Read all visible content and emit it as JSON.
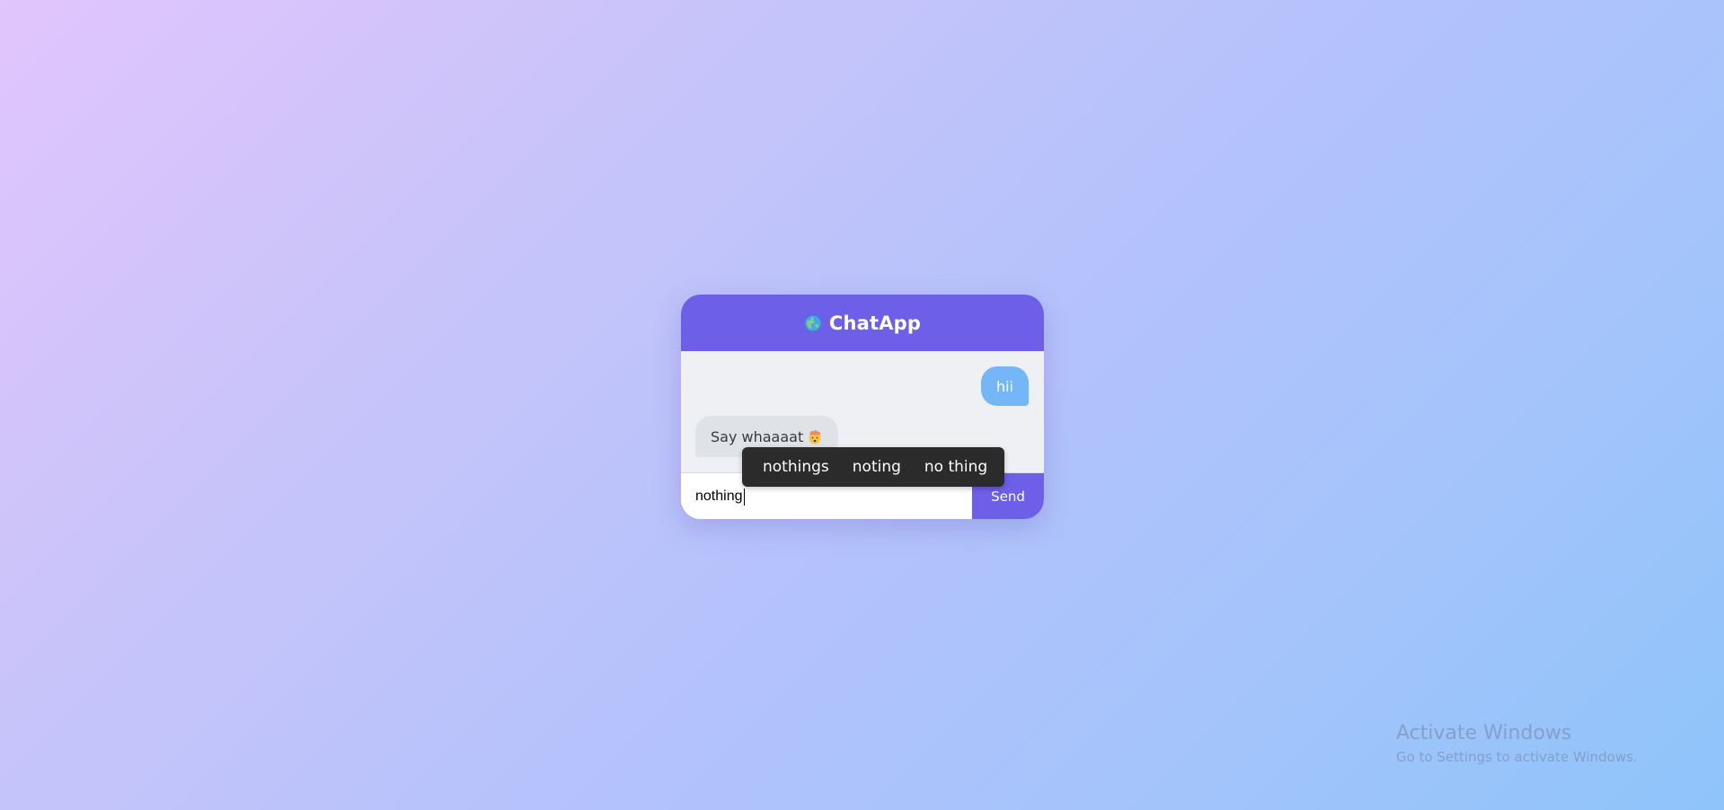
{
  "app": {
    "title": "ChatApp",
    "icon": "globe-icon"
  },
  "messages": [
    {
      "direction": "sent",
      "text": "hii"
    },
    {
      "direction": "received",
      "text": "Say whaaaat",
      "emoji": "exploding-head-emoji"
    }
  ],
  "composer": {
    "value": "nothing",
    "send_label": "Send"
  },
  "autocorrect": {
    "suggestions": [
      "nothings",
      "noting",
      "no thing"
    ]
  },
  "watermark": {
    "title": "Activate Windows",
    "subtitle": "Go to Settings to activate Windows."
  },
  "colors": {
    "accent": "#6d5fe8",
    "sent_bubble": "#74b6f7",
    "received_bubble": "#dfe3e8",
    "chat_background": "#eef0f4",
    "popup_background": "#2b2b2b"
  }
}
